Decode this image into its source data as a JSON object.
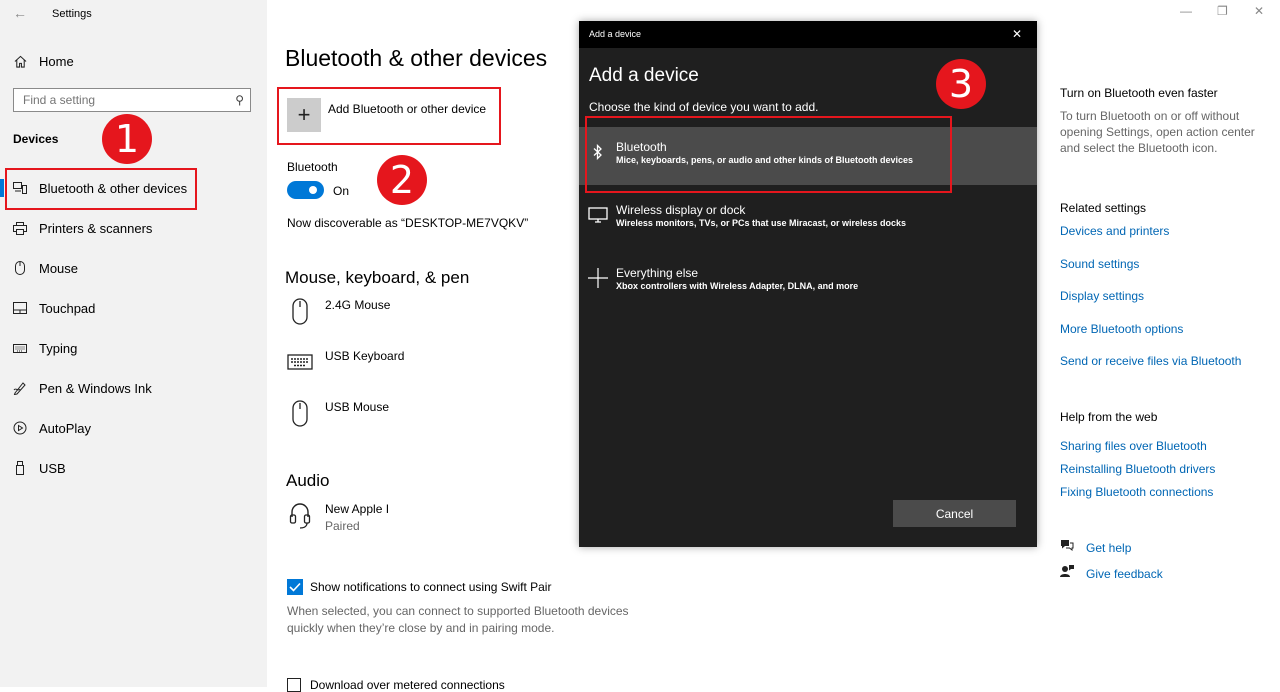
{
  "window": {
    "title": "Settings",
    "minimize_glyph": "—",
    "restore_glyph": "❐",
    "close_glyph": "✕"
  },
  "sidebar": {
    "home_label": "Home",
    "search_placeholder": "Find a setting",
    "section_label": "Devices",
    "items": [
      {
        "label": "Bluetooth & other devices",
        "icon": "bluetooth-devices-icon"
      },
      {
        "label": "Printers & scanners",
        "icon": "printer-icon"
      },
      {
        "label": "Mouse",
        "icon": "mouse-icon"
      },
      {
        "label": "Touchpad",
        "icon": "touchpad-icon"
      },
      {
        "label": "Typing",
        "icon": "keyboard-icon"
      },
      {
        "label": "Pen & Windows Ink",
        "icon": "pen-icon"
      },
      {
        "label": "AutoPlay",
        "icon": "autoplay-icon"
      },
      {
        "label": "USB",
        "icon": "usb-icon"
      }
    ]
  },
  "annotations": {
    "badge1": "1",
    "badge2": "2",
    "badge3": "3"
  },
  "main": {
    "title": "Bluetooth & other devices",
    "add_device_label": "Add Bluetooth or other device",
    "bluetooth_label": "Bluetooth",
    "bluetooth_state": "On",
    "discoverable_text": "Now discoverable as “DESKTOP-ME7VQKV”",
    "mouse_section": "Mouse, keyboard, & pen",
    "devices": [
      {
        "name": "2.4G Mouse",
        "icon": "mouse-icon"
      },
      {
        "name": "USB Keyboard",
        "icon": "keyboard-icon"
      },
      {
        "name": "USB Mouse",
        "icon": "mouse-icon"
      }
    ],
    "audio_section": "Audio",
    "audio_device": {
      "name": "New Apple I",
      "status": "Paired",
      "icon": "headset-icon"
    },
    "swift_pair_label": "Show notifications to connect using Swift Pair",
    "swift_pair_desc": "When selected, you can connect to supported Bluetooth devices quickly when they’re close by and in pairing mode.",
    "metered_label": "Download over metered connections"
  },
  "right_panel": {
    "tip_title": "Turn on Bluetooth even faster",
    "tip_text": "To turn Bluetooth on or off without opening Settings, open action center and select the Bluetooth icon.",
    "related_title": "Related settings",
    "related_links": [
      "Devices and printers",
      "Sound settings",
      "Display settings",
      "More Bluetooth options",
      "Send or receive files via Bluetooth"
    ],
    "help_title": "Help from the web",
    "help_links": [
      "Sharing files over Bluetooth",
      "Reinstalling Bluetooth drivers",
      "Fixing Bluetooth connections"
    ],
    "get_help": "Get help",
    "give_feedback": "Give feedback"
  },
  "dialog": {
    "window_title": "Add a device",
    "heading": "Add a device",
    "subtitle": "Choose the kind of device you want to add.",
    "options": [
      {
        "title": "Bluetooth",
        "desc": "Mice, keyboards, pens, or audio and other kinds of Bluetooth devices",
        "icon": "bluetooth-icon"
      },
      {
        "title": "Wireless display or dock",
        "desc": "Wireless monitors, TVs, or PCs that use Miracast, or wireless docks",
        "icon": "monitor-icon"
      },
      {
        "title": "Everything else",
        "desc": "Xbox controllers with Wireless Adapter, DLNA, and more",
        "icon": "plus-icon"
      }
    ],
    "cancel_label": "Cancel"
  },
  "colors": {
    "accent": "#0078d7",
    "link": "#0066b4",
    "annotation": "#e5161d",
    "dialog_bg": "#1f1f1f"
  }
}
